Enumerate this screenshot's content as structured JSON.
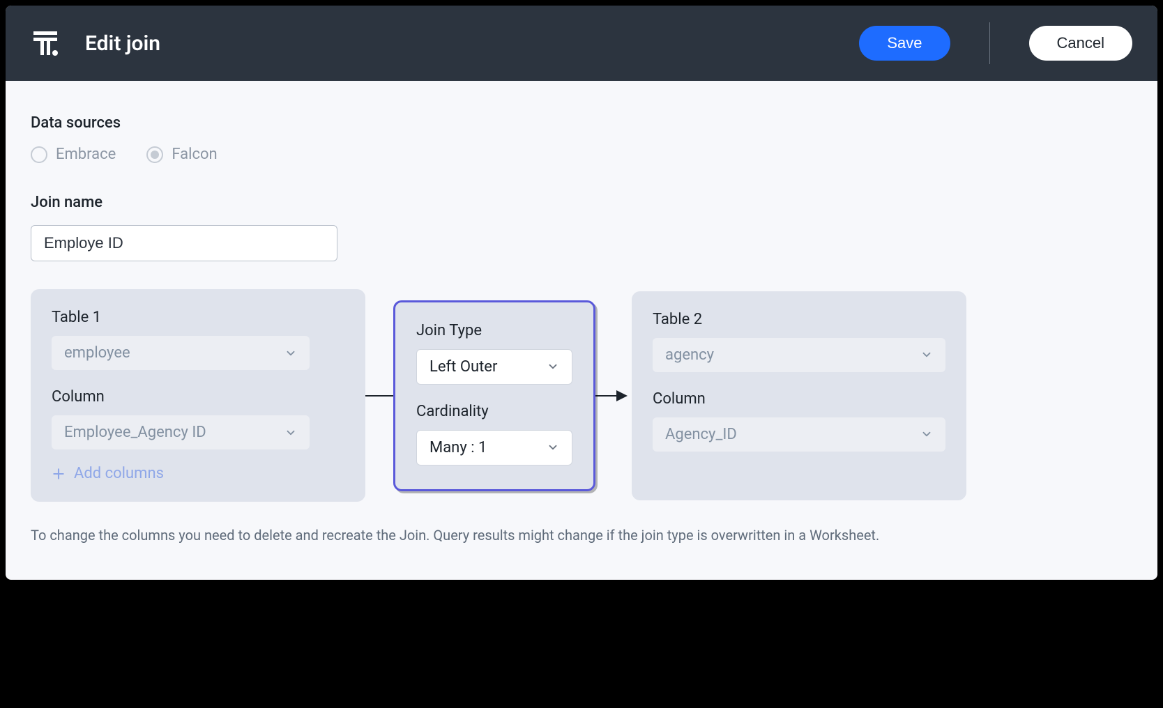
{
  "header": {
    "title": "Edit join",
    "save_label": "Save",
    "cancel_label": "Cancel"
  },
  "data_sources": {
    "label": "Data sources",
    "options": [
      {
        "label": "Embrace",
        "selected": false
      },
      {
        "label": "Falcon",
        "selected": true
      }
    ]
  },
  "join_name": {
    "label": "Join name",
    "value": "Employe ID"
  },
  "table1": {
    "title": "Table 1",
    "table_value": "employee",
    "column_label": "Column",
    "column_value": "Employee_Agency ID",
    "add_label": "Add columns"
  },
  "join_config": {
    "type_label": "Join Type",
    "type_value": "Left Outer",
    "cardinality_label": "Cardinality",
    "cardinality_value": "Many : 1"
  },
  "table2": {
    "title": "Table 2",
    "table_value": "agency",
    "column_label": "Column",
    "column_value": "Agency_ID"
  },
  "footer": "To change the columns you need to delete and recreate the Join. Query results might change if the join type is overwritten in a Worksheet."
}
